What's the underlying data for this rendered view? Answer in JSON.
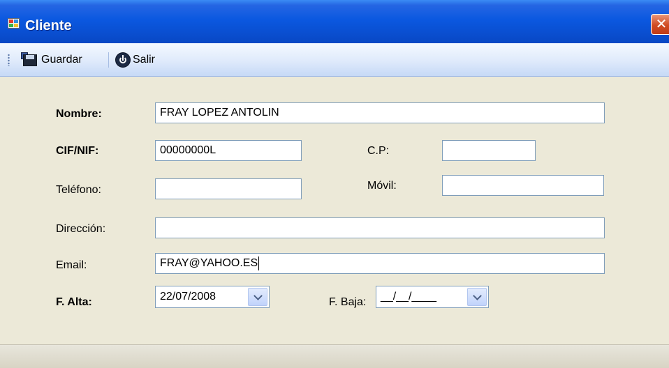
{
  "window": {
    "title": "Cliente",
    "close_label": "✕"
  },
  "toolbar": {
    "save_label": "Guardar",
    "exit_label": "Salir"
  },
  "form": {
    "nombre": {
      "label": "Nombre:",
      "value": "FRAY LOPEZ ANTOLIN"
    },
    "cif_nif": {
      "label": "CIF/NIF:",
      "value": "00000000L"
    },
    "cp": {
      "label": "C.P:",
      "value": ""
    },
    "telefono": {
      "label": "Teléfono:",
      "value": ""
    },
    "movil": {
      "label": "Móvil:",
      "value": ""
    },
    "direccion": {
      "label": "Dirección:",
      "value": ""
    },
    "email": {
      "label": "Email:",
      "value": "FRAY@YAHOO.ES"
    },
    "f_alta": {
      "label": "F. Alta:",
      "value": "22/07/2008"
    },
    "f_baja": {
      "label": "F. Baja:",
      "value": "__/__/____"
    }
  }
}
